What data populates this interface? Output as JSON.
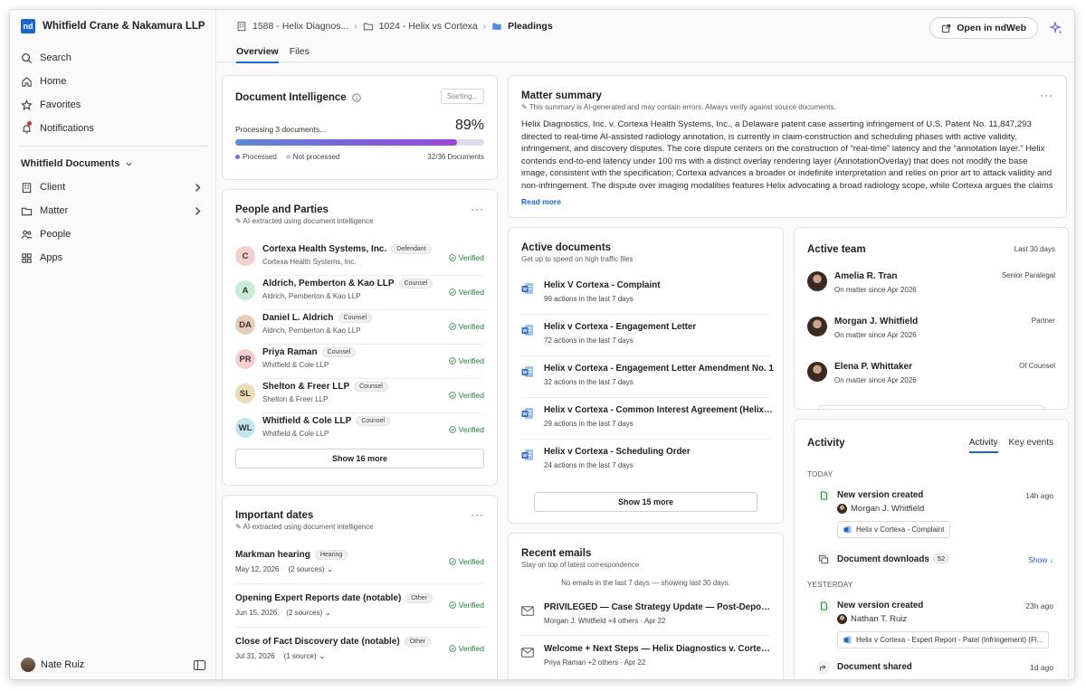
{
  "sidebar": {
    "brand": {
      "logo": "nd",
      "name": "Whitfield Crane & Nakamura LLP"
    },
    "nav": [
      {
        "label": "Search",
        "icon": "search-icon"
      },
      {
        "label": "Home",
        "icon": "home-icon"
      },
      {
        "label": "Favorites",
        "icon": "star-icon"
      },
      {
        "label": "Notifications",
        "icon": "bell-icon"
      }
    ],
    "group_label": "Whitfield Documents",
    "group_items": [
      {
        "label": "Client",
        "icon": "building-icon"
      },
      {
        "label": "Matter",
        "icon": "folder-icon"
      },
      {
        "label": "People",
        "icon": "people-icon"
      },
      {
        "label": "Apps",
        "icon": "apps-icon"
      }
    ],
    "user": "Nate Ruiz"
  },
  "header": {
    "breadcrumb": [
      "1588 - Helix Diagnos...",
      "1024 - Helix vs Cortexa",
      "Pleadings"
    ],
    "tabs": [
      "Overview",
      "Files"
    ],
    "open_button": "Open in ndWeb"
  },
  "doc_intel": {
    "title": "Document Intelligence",
    "button": "Starting...",
    "status": "Processing 3 documents...",
    "percent": "89%",
    "progress": 0.89,
    "legend_processed": "Processed",
    "legend_not": "Not processed",
    "count": "32/36 Documents"
  },
  "people": {
    "title": "People and Parties",
    "subtitle": "AI-extracted using document intelligence",
    "verified_label": "Verified",
    "items": [
      {
        "initials": "C",
        "name": "Cortexa Health Systems, Inc.",
        "badge": "Defendant",
        "org": "Cortexa Health Systems, Inc.",
        "color": "#f3cfd0"
      },
      {
        "initials": "A",
        "name": "Aldrich, Pemberton & Kao LLP",
        "badge": "Counsel",
        "org": "Aldrich, Pemberton & Kao LLP",
        "color": "#c9ecd9"
      },
      {
        "initials": "DA",
        "name": "Daniel L. Aldrich",
        "badge": "Counsel",
        "org": "Aldrich, Pemberton & Kao LLP",
        "color": "#e7cdb8"
      },
      {
        "initials": "PR",
        "name": "Priya Raman",
        "badge": "Counsel",
        "org": "Whitfield & Cole LLP",
        "color": "#f6cdd0"
      },
      {
        "initials": "SL",
        "name": "Shelton & Freer LLP",
        "badge": "Counsel",
        "org": "Shelton & Freer LLP",
        "color": "#ecdcb8"
      },
      {
        "initials": "WL",
        "name": "Whitfield & Cole LLP",
        "badge": "Counsel",
        "org": "Whitfield & Cole LLP",
        "color": "#bfe6ea"
      }
    ],
    "show_more": "Show 16 more"
  },
  "dates": {
    "title": "Important dates",
    "subtitle": "AI-extracted using document intelligence",
    "items": [
      {
        "name": "Markman hearing",
        "badge": "Hearing",
        "date": "May 12, 2026",
        "sources": "(2 sources)"
      },
      {
        "name": "Opening Expert Reports date (notable)",
        "badge": "Other",
        "date": "Jun 15, 2026",
        "sources": "(2 sources)"
      },
      {
        "name": "Close of Fact Discovery date (notable)",
        "badge": "Other",
        "date": "Jul 31, 2026",
        "sources": "(1 source)"
      }
    ]
  },
  "summary": {
    "title": "Matter summary",
    "disclaimer": "This summary is AI-generated and may contain errors. Always verify against source documents.",
    "text": "Helix Diagnostics, Inc. v. Cortexa Health Systems, Inc., a Delaware patent case asserting infringement of U.S. Patent No. 11,847,293 directed to real-time AI-assisted radiology annotation, is currently in claim-construction and scheduling phases with active validity, infringement, and discovery disputes. The core dispute centers on the construction of “real-time” latency and the “annotation layer.” Helix contends end-to-end latency under 100 ms with a distinct overlay rendering layer (AnnotationOverlay) that does not modify the base image, consistent with the specification; Cortexa advances a broader or indefinite interpretation and relies on prior art to attack validity and non-infringement. The dispute over imaging modalities features Helix advocating a broad radiology scope, while Cortexa argues the claims ar...",
    "read_more": "Read more"
  },
  "active_docs": {
    "title": "Active documents",
    "subtitle": "Get up to speed on high traffic files",
    "items": [
      {
        "name": "Helix V Cortexa - Complaint",
        "meta": "99 actions in the last 7 days"
      },
      {
        "name": "Helix v Cortexa - Engagement Letter",
        "meta": "72 actions in the last 7 days"
      },
      {
        "name": "Helix v Cortexa - Engagement Letter Amendment No. 1",
        "meta": "32 actions in the last 7 days"
      },
      {
        "name": "Helix v Cortexa - Common Interest Agreement (Helix-R...",
        "meta": "29 actions in the last 7 days"
      },
      {
        "name": "Helix v Cortexa - Scheduling Order",
        "meta": "24 actions in the last 7 days"
      }
    ],
    "show_more": "Show 15 more"
  },
  "emails": {
    "title": "Recent emails",
    "subtitle": "Stay on top of latest correspondence",
    "notice": "No emails in the last 7 days — showing last 30 days.",
    "items": [
      {
        "subject": "PRIVILEGED — Case Strategy Update — Post-Depositio...",
        "meta": "Morgan J. Whitfield +4 others · Apr 22"
      },
      {
        "subject": "Welcome + Next Steps — Helix Diagnostics v. Cortexa ...",
        "meta": "Priya Raman +2 others · Apr 22"
      }
    ]
  },
  "team": {
    "title": "Active team",
    "range": "Last 30 days",
    "members": [
      {
        "name": "Amelia R. Tran",
        "since": "On matter since Apr 2026",
        "role": "Senior Paralegal"
      },
      {
        "name": "Morgan J. Whitfield",
        "since": "On matter since Apr 2026",
        "role": "Partner"
      },
      {
        "name": "Elena P. Whittaker",
        "since": "On matter since Apr 2026",
        "role": "Of Counsel"
      }
    ]
  },
  "activity": {
    "title": "Activity",
    "tabs": [
      "Activity",
      "Key events"
    ],
    "today": "TODAY",
    "yesterday": "YESTERDAY",
    "e1": {
      "title": "New version created",
      "time": "14h ago",
      "by": "Morgan J. Whitfield",
      "file": "Helix v Cortexa - Complaint"
    },
    "e2": {
      "title": "Document downloads",
      "count": "52",
      "show": "Show ↓"
    },
    "e3": {
      "title": "New version created",
      "time": "23h ago",
      "by": "Nathan T. Ruiz",
      "file": "Helix v Cortexa - Expert Report - Patel (Infringement) (Fl..."
    },
    "e4": {
      "title": "Document shared",
      "time": "1d ago"
    }
  },
  "colors": {
    "accent": "#1a66d2",
    "verified": "#1d7a3a",
    "progress_start": "#5b8bd6",
    "progress_end": "#9b49d4"
  }
}
